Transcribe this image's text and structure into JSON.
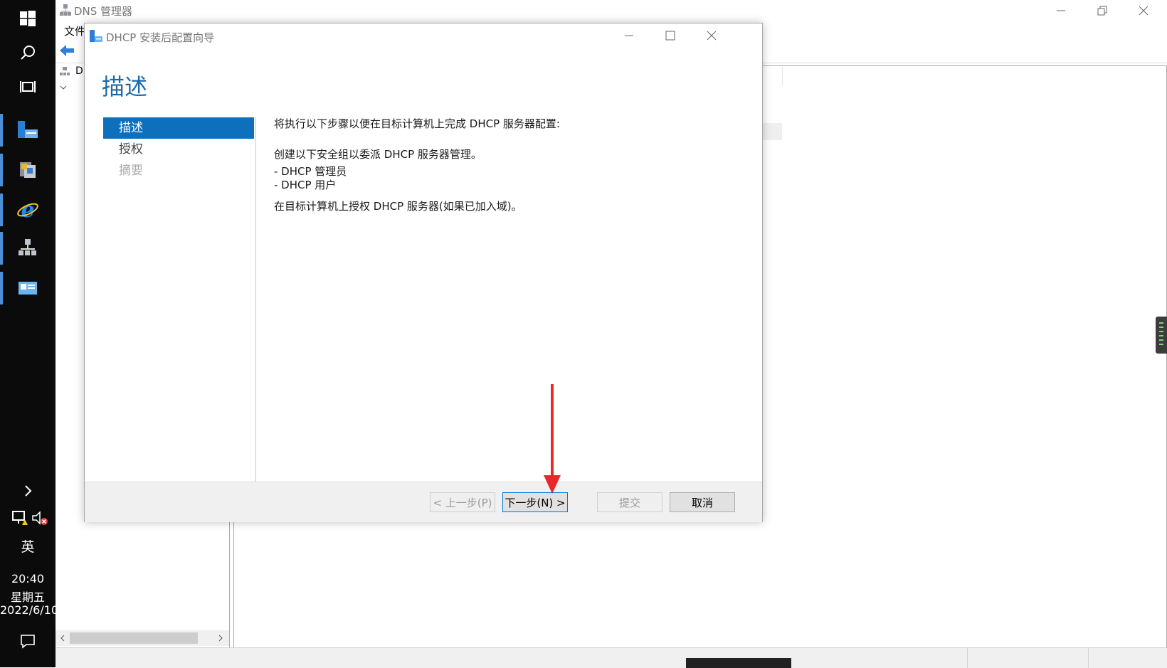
{
  "taskbar": {
    "input_indicator": "英",
    "clock_time": "20:40",
    "clock_day": "星期五",
    "clock_date": "2022/6/10"
  },
  "dns_window": {
    "title": "DNS 管理器",
    "menu_file": "文件",
    "tree_root_initial": "D"
  },
  "dialog": {
    "title": "DHCP 安装后配置向导",
    "heading": "描述",
    "nav": [
      {
        "label": "描述",
        "state": "active"
      },
      {
        "label": "授权",
        "state": "normal"
      },
      {
        "label": "摘要",
        "state": "disabled"
      }
    ],
    "content": {
      "intro": "将执行以下步骤以便在目标计算机上完成 DHCP 服务器配置:",
      "groups_intro": "创建以下安全组以委派 DHCP 服务器管理。",
      "group_1": "- DHCP 管理员",
      "group_2": "- DHCP 用户",
      "authorize": "在目标计算机上授权 DHCP 服务器(如果已加入域)。"
    },
    "buttons": {
      "prev": "< 上一步(P)",
      "next": "下一步(N) >",
      "submit": "提交",
      "cancel": "取消"
    }
  },
  "colors": {
    "accent": "#0e6fbd",
    "heading": "#1c6aa8",
    "annotation_arrow": "#e8282b",
    "taskbar_bg": "#0b0b0b"
  }
}
